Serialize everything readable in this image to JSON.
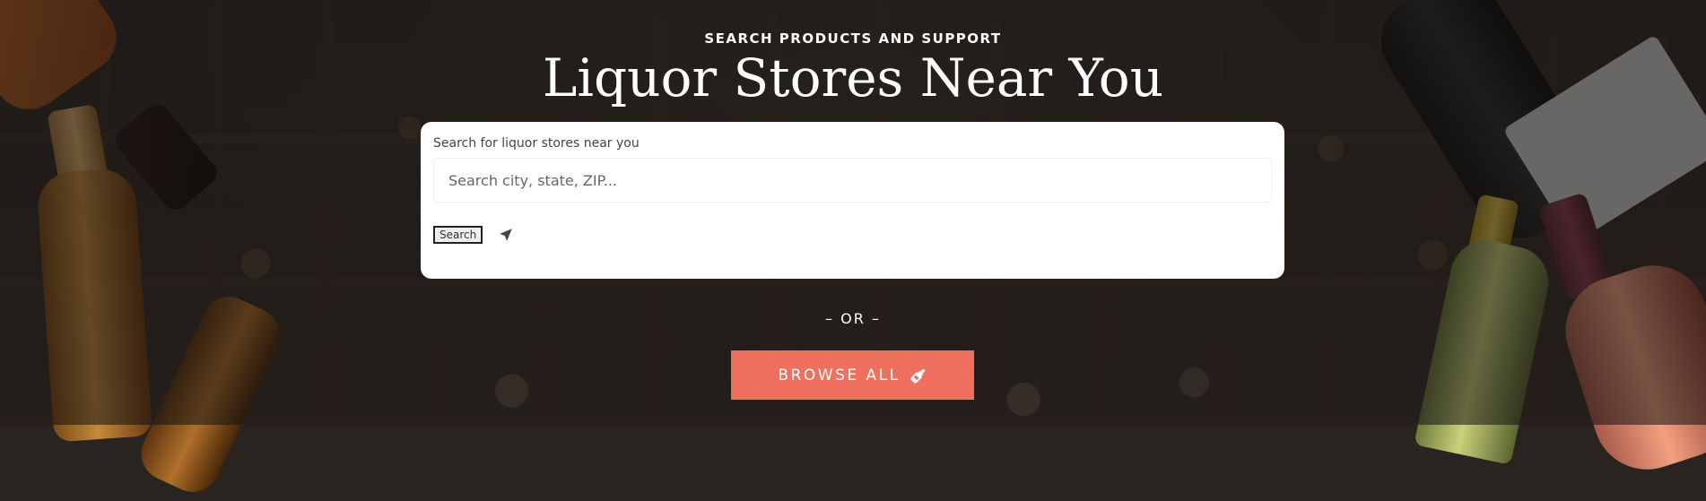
{
  "hero": {
    "kicker": "SEARCH PRODUCTS AND SUPPORT",
    "title": "Liquor Stores Near You"
  },
  "search": {
    "label": "Search for liquor stores near you",
    "placeholder": "Search city, state, ZIP...",
    "button_label": "Search",
    "locate_icon": "location-arrow-icon"
  },
  "divider": {
    "text": "– OR –"
  },
  "browse": {
    "label": "BROWSE ALL",
    "icon": "bottle-icon"
  },
  "colors": {
    "accent": "#f07060",
    "card": "#ffffff"
  }
}
